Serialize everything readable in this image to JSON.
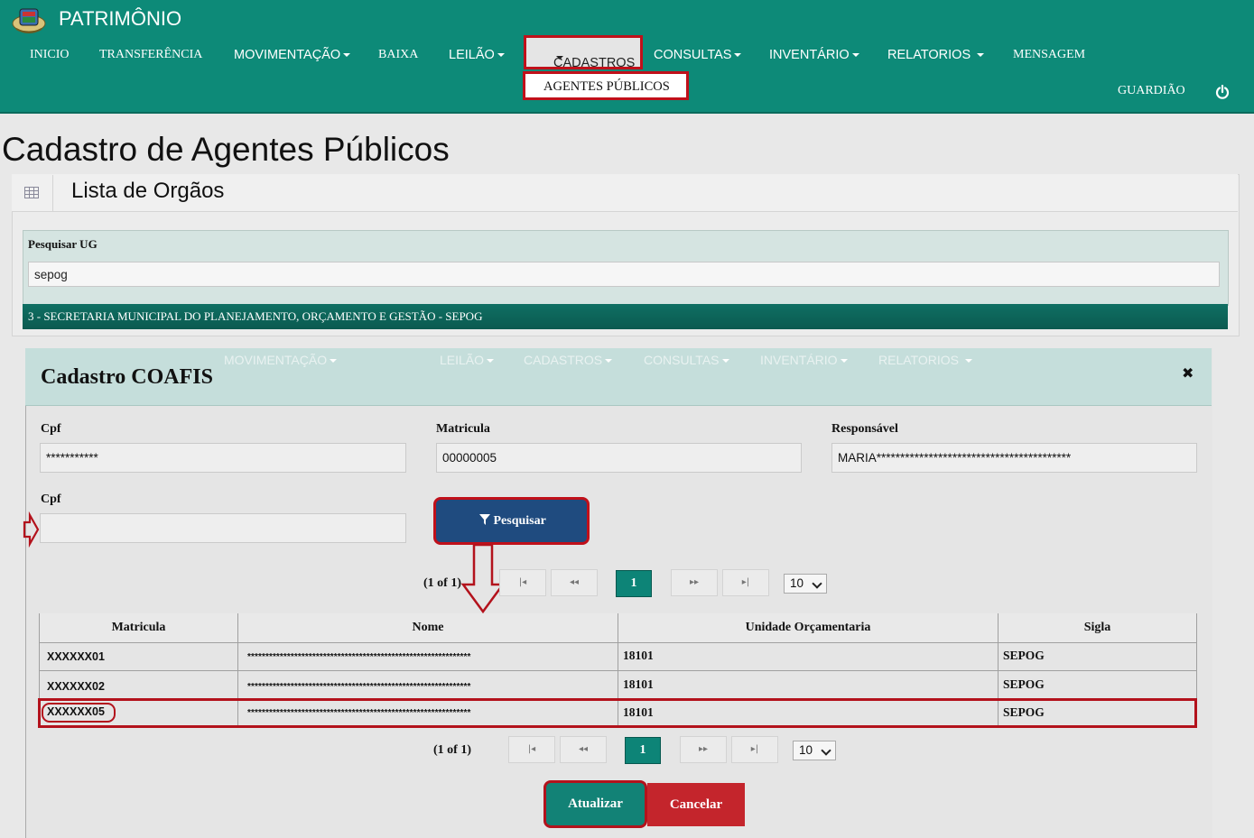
{
  "app": {
    "title": "PATRIMÔNIO"
  },
  "nav": {
    "inicio": "INICIO",
    "transferencia": "TRANSFERÊNCIA",
    "movimentacao": "MOVIMENTAÇÃO",
    "baixa": "BAIXA",
    "leilao": "LEILÃO",
    "cadastros": "CADASTROS",
    "consultas": "CONSULTAS",
    "inventario": "INVENTÁRIO",
    "relatorios": "RELATORIOS",
    "mensagem": "MENSAGEM",
    "submenu_item": "AGENTES PÚBLICOS",
    "user": "GUARDIÃO"
  },
  "page": {
    "title": "Cadastro de Agentes Públicos",
    "panel_title": "Lista de Orgãos",
    "search_label": "Pesquisar UG",
    "search_value": "sepog",
    "ug_result": "3 - SECRETARIA MUNICIPAL DO PLANEJAMENTO, ORÇAMENTO E GESTÃO - SEPOG"
  },
  "modal": {
    "title": "Cadastro COAFIS",
    "ghost_menu": [
      "MOVIMENTAÇÃO",
      "LEILÃO",
      "CADASTROS",
      "CONSULTAS",
      "INVENTÁRIO",
      "RELATORIOS"
    ],
    "cpf_label": "Cpf",
    "cpf_value": "***********",
    "matricula_label": "Matricula",
    "matricula_value": "00000005",
    "responsavel_label": "Responsável",
    "responsavel_value": "MARIA*****************************************",
    "cpf2_label": "Cpf",
    "cpf2_value": "",
    "search_button": "Pesquisar",
    "pager_top": {
      "text": "(1 of 1)",
      "current": "1",
      "rows": "10"
    },
    "pager_bottom": {
      "text": "(1 of 1)",
      "current": "1",
      "rows": "10"
    },
    "table": {
      "headers": [
        "Matricula",
        "Nome",
        "Unidade Orçamentaria",
        "Sigla"
      ],
      "rows": [
        [
          "XXXXXX01",
          "**************************************************************",
          "18101",
          "SEPOG"
        ],
        [
          "XXXXXX02",
          "**************************************************************",
          "18101",
          "SEPOG"
        ],
        [
          "XXXXXX05",
          "**************************************************************",
          "18101",
          "SEPOG"
        ]
      ]
    },
    "update_button": "Atualizar",
    "cancel_button": "Cancelar"
  },
  "colors": {
    "header": "#0d8a78",
    "highlight": "#c0101a",
    "primary": "#1f4b7f",
    "danger": "#c4252c"
  },
  "icons": [
    "logo-icon",
    "caret-down-icon",
    "power-icon",
    "table-icon",
    "close-icon",
    "filter-icon",
    "first-page-icon",
    "prev-page-icon",
    "next-page-icon",
    "last-page-icon",
    "arrow-down-icon",
    "arrow-right-icon"
  ]
}
